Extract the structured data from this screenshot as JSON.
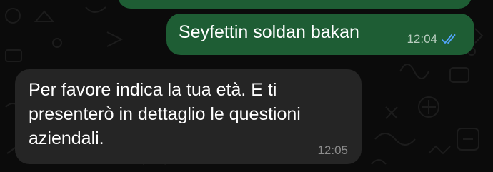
{
  "messages": {
    "outgoing": {
      "text": "Seyfettin soldan bakan",
      "time": "12:04",
      "status_icon": "double-check-read-icon",
      "tick_color": "#53a6ff"
    },
    "incoming": {
      "text": "Per favore indica la tua età. E ti presenterò in dettaglio le questioni aziendali.",
      "time": "12:05"
    }
  },
  "colors": {
    "background": "#0b0b0b",
    "outgoing_bubble": "#1e5d34",
    "incoming_bubble": "#252525"
  }
}
